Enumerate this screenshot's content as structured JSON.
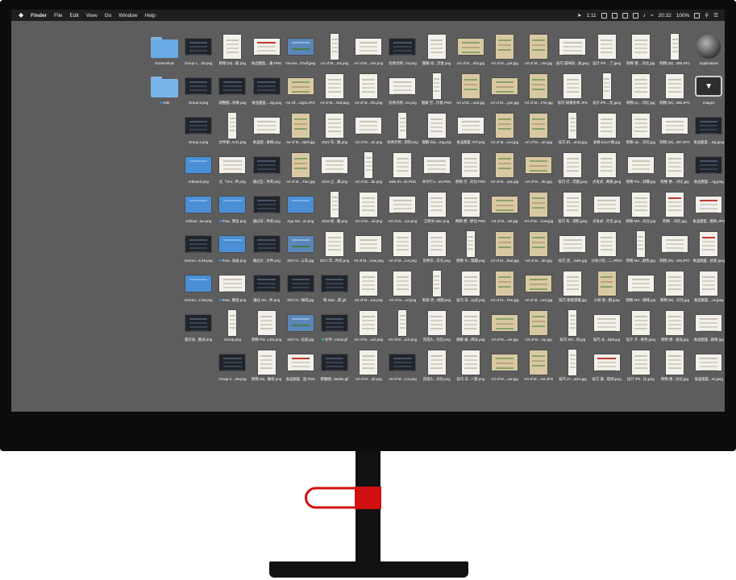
{
  "menubar": {
    "apple": "",
    "app": "Finder",
    "menus": [
      "File",
      "Edit",
      "View",
      "Go",
      "Window",
      "Help"
    ],
    "status": {
      "time_short": "1:11",
      "clock": "20:32",
      "battery": "100%"
    }
  },
  "desktop": {
    "items": [
      {
        "label": "Screenshots",
        "kind": "folder-special",
        "col": 0,
        "row": 0
      },
      {
        "label": "Group 1....09.png",
        "kind": "dark",
        "col": 1,
        "row": 0
      },
      {
        "label": "购物 (M)...取.png",
        "kind": "paper",
        "col": 2,
        "row": 0
      },
      {
        "label": "食品图鉴....册.PNG",
        "kind": "red",
        "col": 3,
        "row": 0
      },
      {
        "label": "Fences...9?ulf.jpeg",
        "kind": "sky",
        "col": 4,
        "row": 0
      },
      {
        "label": "Art of M....nts.png",
        "kind": "paper",
        "col": 5,
        "row": 0
      },
      {
        "label": "Art of M....ons.png",
        "kind": "paper",
        "col": 6,
        "row": 0
      },
      {
        "label": "优秀示例...03.png",
        "kind": "dark",
        "col": 7,
        "row": 0
      },
      {
        "label": "图解 动...示意.png",
        "kind": "paper",
        "col": 8,
        "row": 0
      },
      {
        "label": "Art of M....rlbs.jpg",
        "kind": "map",
        "col": 9,
        "row": 0
      },
      {
        "label": "Art of M....pot.jpg",
        "kind": "map",
        "col": 10,
        "row": 0
      },
      {
        "label": "Art of M....ons.jpg",
        "kind": "map",
        "col": 11,
        "row": 0
      },
      {
        "label": "技巧 猫咪饲...食.jpeg",
        "kind": "paper",
        "col": 12,
        "row": 0
      },
      {
        "label": "设计 iPh....了.jpeg",
        "kind": "paper",
        "col": 13,
        "row": 0
      },
      {
        "label": "购物 便....对比.jpg",
        "kind": "paper",
        "col": 14,
        "row": 0
      },
      {
        "label": "购物 (M)...289.JPG",
        "kind": "paper",
        "col": 15,
        "row": 0
      },
      {
        "label": "Applications",
        "kind": "app",
        "col": 16,
        "row": 0
      },
      {
        "label": "Anki",
        "kind": "folder",
        "col": 0,
        "row": 1,
        "dot": "blue"
      },
      {
        "label": "Group 5.png",
        "kind": "dark",
        "col": 1,
        "row": 1
      },
      {
        "label": "调整图...效果.png",
        "kind": "dark",
        "col": 2,
        "row": 1
      },
      {
        "label": "食品图鉴....ing.png",
        "kind": "dark",
        "col": 3,
        "row": 1
      },
      {
        "label": "Art Of....orgot.JPG",
        "kind": "map",
        "col": 4,
        "row": 1
      },
      {
        "label": "Art of M....tied.png",
        "kind": "paper",
        "col": 5,
        "row": 1
      },
      {
        "label": "Art of M....ifts.png",
        "kind": "paper",
        "col": 6,
        "row": 1
      },
      {
        "label": "优秀示例...01.png",
        "kind": "paper",
        "col": 7,
        "row": 1
      },
      {
        "label": "图解 空...示意.PNG",
        "kind": "paper",
        "col": 8,
        "row": 1
      },
      {
        "label": "Art of M....ossl.jpg",
        "kind": "map",
        "col": 9,
        "row": 1
      },
      {
        "label": "Art of M....ycle.jpg",
        "kind": "map",
        "col": 10,
        "row": 1
      },
      {
        "label": "Art of M....Fire.jpg",
        "kind": "map",
        "col": 11,
        "row": 1
      },
      {
        "label": "技巧 如果冬季.JPG",
        "kind": "paper",
        "col": 12,
        "row": 1
      },
      {
        "label": "设计 iPh....比.jpeg",
        "kind": "paper",
        "col": 13,
        "row": 1
      },
      {
        "label": "购物 cp....对比.jpg",
        "kind": "paper",
        "col": 14,
        "row": 1
      },
      {
        "label": "购物 (M)...288.JPG",
        "kind": "paper",
        "col": 15,
        "row": 1
      },
      {
        "label": "Images",
        "kind": "images",
        "col": 16,
        "row": 1
      },
      {
        "label": "Group 2.png",
        "kind": "dark",
        "col": 1,
        "row": 2
      },
      {
        "label": "文件图...9.01.png",
        "kind": "paper",
        "col": 2,
        "row": 2
      },
      {
        "label": "食品图...食物.png",
        "kind": "paper",
        "col": 3,
        "row": 2
      },
      {
        "label": "Art of M....abel.jpg",
        "kind": "map",
        "col": 4,
        "row": 2
      },
      {
        "label": "2022 有...图.png",
        "kind": "paper",
        "col": 5,
        "row": 2
      },
      {
        "label": "Art of M....an.png",
        "kind": "paper",
        "col": 6,
        "row": 2
      },
      {
        "label": "优秀示例...项目.png",
        "kind": "paper",
        "col": 7,
        "row": 2
      },
      {
        "label": "图解 Dia....ing.png",
        "kind": "paper",
        "col": 8,
        "row": 2
      },
      {
        "label": "食品图鉴 ATP.png",
        "kind": "paper",
        "col": 9,
        "row": 2
      },
      {
        "label": "Art of M....iver.jpg",
        "kind": "map",
        "col": 10,
        "row": 2
      },
      {
        "label": "Art of M....urn.jpg",
        "kind": "map",
        "col": 11,
        "row": 2
      },
      {
        "label": "技巧 机....acks.jpg",
        "kind": "paper",
        "col": 12,
        "row": 2
      },
      {
        "label": "表格 Excel 数.jpg",
        "kind": "paper",
        "col": 13,
        "row": 2
      },
      {
        "label": "购物 cpl....对比.jpg",
        "kind": "paper",
        "col": 14,
        "row": 2
      },
      {
        "label": "购物 (M)...287.JPG",
        "kind": "paper",
        "col": 15,
        "row": 2
      },
      {
        "label": "食品图鉴....ing.jpeg",
        "kind": "dark",
        "col": 16,
        "row": 2
      },
      {
        "label": "Artboard.png",
        "kind": "blue",
        "col": 1,
        "row": 3
      },
      {
        "label": "在「Gro...件.png",
        "kind": "paper",
        "col": 2,
        "row": 3
      },
      {
        "label": "通过互...件夹.png",
        "kind": "dark",
        "col": 3,
        "row": 3
      },
      {
        "label": "Art of M....Ties.jpg",
        "kind": "map",
        "col": 4,
        "row": 3
      },
      {
        "label": "2019 之...课.png",
        "kind": "paper",
        "col": 5,
        "row": 3
      },
      {
        "label": "Art of M....de.png",
        "kind": "paper",
        "col": 6,
        "row": 3
      },
      {
        "label": "Julia Ev...ds.PNG",
        "kind": "paper",
        "col": 7,
        "row": 3
      },
      {
        "label": "命令行 s...ds.PNG",
        "kind": "paper",
        "col": 8,
        "row": 3
      },
      {
        "label": "购物 空...对比.PNG",
        "kind": "paper",
        "col": 9,
        "row": 3
      },
      {
        "label": "Art of M....ope.jpg",
        "kind": "map",
        "col": 10,
        "row": 3
      },
      {
        "label": "Art of M....ide.jpg",
        "kind": "map",
        "col": 11,
        "row": 3
      },
      {
        "label": "技巧 打...范图.jpeg",
        "kind": "paper",
        "col": 12,
        "row": 3
      },
      {
        "label": "点发式...两格.jpeg",
        "kind": "paper",
        "col": 13,
        "row": 3
      },
      {
        "label": "购物 Pre...封罐.jpg",
        "kind": "paper",
        "col": 14,
        "row": 3
      },
      {
        "label": "购物 便....对比.jpg",
        "kind": "paper",
        "col": 15,
        "row": 3
      },
      {
        "label": "食品图鉴....ng.jpeg",
        "kind": "dark",
        "col": 16,
        "row": 3
      },
      {
        "label": "Artboar...lue.png",
        "kind": "blue",
        "col": 1,
        "row": 4
      },
      {
        "label": "Pow...预览.png",
        "kind": "blue",
        "col": 2,
        "row": 4,
        "dot": "blue"
      },
      {
        "label": "通过日...件夹.png",
        "kind": "dark",
        "col": 3,
        "row": 4
      },
      {
        "label": "App Sto...an.png",
        "kind": "blue",
        "col": 4,
        "row": 4
      },
      {
        "label": "2018 初...图.png",
        "kind": "paper",
        "col": 5,
        "row": 4
      },
      {
        "label": "Art of M....od.png",
        "kind": "paper",
        "col": 6,
        "row": 4
      },
      {
        "label": "Art of M....cos.png",
        "kind": "paper",
        "col": 7,
        "row": 4
      },
      {
        "label": "言频文 Mac.png",
        "kind": "paper",
        "col": 8,
        "row": 4
      },
      {
        "label": "购物 便...原位.PNG",
        "kind": "paper",
        "col": 9,
        "row": 4
      },
      {
        "label": "Art of M....ssl.jpg",
        "kind": "map",
        "col": 10,
        "row": 4
      },
      {
        "label": "Art of M....Cow.jpg",
        "kind": "map",
        "col": 11,
        "row": 4
      },
      {
        "label": "技巧 有...调织.jpeg",
        "kind": "paper",
        "col": 12,
        "row": 4
      },
      {
        "label": "点发式...元音.jpeg",
        "kind": "paper",
        "col": 13,
        "row": 4
      },
      {
        "label": "购物 MO...对比.jpg",
        "kind": "paper",
        "col": 14,
        "row": 4
      },
      {
        "label": "购物 ...对比.jpg",
        "kind": "red",
        "col": 15,
        "row": 4
      },
      {
        "label": "食品图鉴...图例.JPG",
        "kind": "red",
        "col": 16,
        "row": 4
      },
      {
        "label": "Screen...6.46.png",
        "kind": "dark",
        "col": 1,
        "row": 5
      },
      {
        "label": "Pow...动画.png",
        "kind": "blue",
        "col": 2,
        "row": 5,
        "dot": "blue"
      },
      {
        "label": "通过文...文件.png",
        "kind": "dark",
        "col": 3,
        "row": 5
      },
      {
        "label": "2017-0...公车.jpg",
        "kind": "sky",
        "col": 4,
        "row": 5
      },
      {
        "label": "2017 年...时光.png",
        "kind": "paper",
        "col": 5,
        "row": 5
      },
      {
        "label": "Art of M....rcse.png",
        "kind": "paper",
        "col": 6,
        "row": 5
      },
      {
        "label": "Art of M....ion.png",
        "kind": "paper",
        "col": 7,
        "row": 5
      },
      {
        "label": "优秀示...符号.png",
        "kind": "paper",
        "col": 8,
        "row": 5
      },
      {
        "label": "购物 Tc...瑞典.png",
        "kind": "paper",
        "col": 9,
        "row": 5
      },
      {
        "label": "Art of M....Bod.jpg",
        "kind": "map",
        "col": 10,
        "row": 5
      },
      {
        "label": "Art of M....ids.jpg",
        "kind": "map",
        "col": 11,
        "row": 5
      },
      {
        "label": "技巧 变....Safe.jpg",
        "kind": "paper",
        "col": 12,
        "row": 5
      },
      {
        "label": "沙县小吃...二.JPEG",
        "kind": "paper",
        "col": 13,
        "row": 5
      },
      {
        "label": "购物 MA...颜色.jpg",
        "kind": "paper",
        "col": 14,
        "row": 5
      },
      {
        "label": "购物 (M)...100.JPG",
        "kind": "paper",
        "col": 15,
        "row": 5
      },
      {
        "label": "食品图鉴...甘蔗.jpeg",
        "kind": "red",
        "col": 16,
        "row": 5
      },
      {
        "label": "Screen...2.26.png",
        "kind": "blue",
        "col": 1,
        "row": 6
      },
      {
        "label": "Pow...教程.png",
        "kind": "paper",
        "col": 2,
        "row": 6,
        "dot": "blue"
      },
      {
        "label": "通过 Dis...件.png",
        "kind": "dark",
        "col": 3,
        "row": 6
      },
      {
        "label": "2017-0...咖啡.jpg",
        "kind": "dark",
        "col": 4,
        "row": 6
      },
      {
        "label": "将 Stac...库.gif",
        "kind": "dark",
        "col": 5,
        "row": 6
      },
      {
        "label": "Art of M....me.png",
        "kind": "paper",
        "col": 6,
        "row": 6
      },
      {
        "label": "Art of M....ed.png",
        "kind": "paper",
        "col": 7,
        "row": 6
      },
      {
        "label": "附表 世...地图.png",
        "kind": "paper",
        "col": 8,
        "row": 6
      },
      {
        "label": "技巧 日...公式.png",
        "kind": "paper",
        "col": 9,
        "row": 6
      },
      {
        "label": "Art of M....Fire.jpg",
        "kind": "map",
        "col": 10,
        "row": 6
      },
      {
        "label": "Art of M....ees.jpg",
        "kind": "map",
        "col": 11,
        "row": 6
      },
      {
        "label": "技巧 德使遗嘱.jpg",
        "kind": "paper",
        "col": 12,
        "row": 6
      },
      {
        "label": "沙县 地...图.jpeg",
        "kind": "map",
        "col": 13,
        "row": 6
      },
      {
        "label": "购物 MO...咖啡.jpg",
        "kind": "paper",
        "col": 14,
        "row": 6
      },
      {
        "label": "购物 (M)...对比.jpg",
        "kind": "paper",
        "col": 15,
        "row": 6
      },
      {
        "label": "食品图鉴....ns.jpeg",
        "kind": "paper",
        "col": 16,
        "row": 6
      },
      {
        "label": "提示表...图式.png",
        "kind": "dark",
        "col": 1,
        "row": 7
      },
      {
        "label": "Group.png",
        "kind": "paper",
        "col": 2,
        "row": 7
      },
      {
        "label": "购物 Pol...LES.png",
        "kind": "paper",
        "col": 3,
        "row": 7
      },
      {
        "label": "2017-0...垃圾.jpg",
        "kind": "sky",
        "col": 4,
        "row": 7
      },
      {
        "label": "文件...e41d.gif",
        "kind": "dark",
        "col": 5,
        "row": 7,
        "dot": "green"
      },
      {
        "label": "Art of M....uck.png",
        "kind": "paper",
        "col": 6,
        "row": 7
      },
      {
        "label": "Art of M....uck.png",
        "kind": "paper",
        "col": 7,
        "row": 7
      },
      {
        "label": "充电头...对比.png",
        "kind": "paper",
        "col": 8,
        "row": 7
      },
      {
        "label": "图解 被...绑法.png",
        "kind": "paper",
        "col": 9,
        "row": 7
      },
      {
        "label": "Art of M....oor.jpg",
        "kind": "map",
        "col": 10,
        "row": 7
      },
      {
        "label": "Art of M....Up.jpg",
        "kind": "map",
        "col": 11,
        "row": 7
      },
      {
        "label": "技巧 MS...效.jpg",
        "kind": "paper",
        "col": 12,
        "row": 7
      },
      {
        "label": "技巧 长...light.jpg",
        "kind": "paper",
        "col": 13,
        "row": 7
      },
      {
        "label": "设计 子...果色.jpeg",
        "kind": "paper",
        "col": 14,
        "row": 7
      },
      {
        "label": "购物 便...食品.jpg",
        "kind": "paper",
        "col": 15,
        "row": 7
      },
      {
        "label": "食品图鉴...颜格.jpg",
        "kind": "paper",
        "col": 16,
        "row": 7
      },
      {
        "label": "Group 2....05.png",
        "kind": "dark",
        "col": 2,
        "row": 8
      },
      {
        "label": "购物 Ma...咖啡.png",
        "kind": "paper",
        "col": 3,
        "row": 8
      },
      {
        "label": "食品图鉴...显.PNG",
        "kind": "red",
        "col": 4,
        "row": 8
      },
      {
        "label": "把额图...8a0be.gif",
        "kind": "dark",
        "col": 5,
        "row": 8
      },
      {
        "label": "Art of M....all.png",
        "kind": "paper",
        "col": 6,
        "row": 8
      },
      {
        "label": "Art of M....ion.png",
        "kind": "dark",
        "col": 7,
        "row": 8
      },
      {
        "label": "充电头...对比.png",
        "kind": "paper",
        "col": 8,
        "row": 8
      },
      {
        "label": "技巧 日...7 题.png",
        "kind": "paper",
        "col": 9,
        "row": 8
      },
      {
        "label": "Art of M....oor.jpg",
        "kind": "map",
        "col": 10,
        "row": 8
      },
      {
        "label": "Art of M....ent.JPG",
        "kind": "map",
        "col": 11,
        "row": 8
      },
      {
        "label": "技巧 27...acks.jpg",
        "kind": "paper",
        "col": 12,
        "row": 8
      },
      {
        "label": "技巧 谋...理讲.jpeg",
        "kind": "red",
        "col": 13,
        "row": 8
      },
      {
        "label": "设计 iPh...比.jpeg",
        "kind": "paper",
        "col": 14,
        "row": 8
      },
      {
        "label": "购物 便...对比.jpg",
        "kind": "paper",
        "col": 15,
        "row": 8
      },
      {
        "label": "食品图鉴...ns.jpeg",
        "kind": "paper",
        "col": 16,
        "row": 8
      }
    ]
  }
}
